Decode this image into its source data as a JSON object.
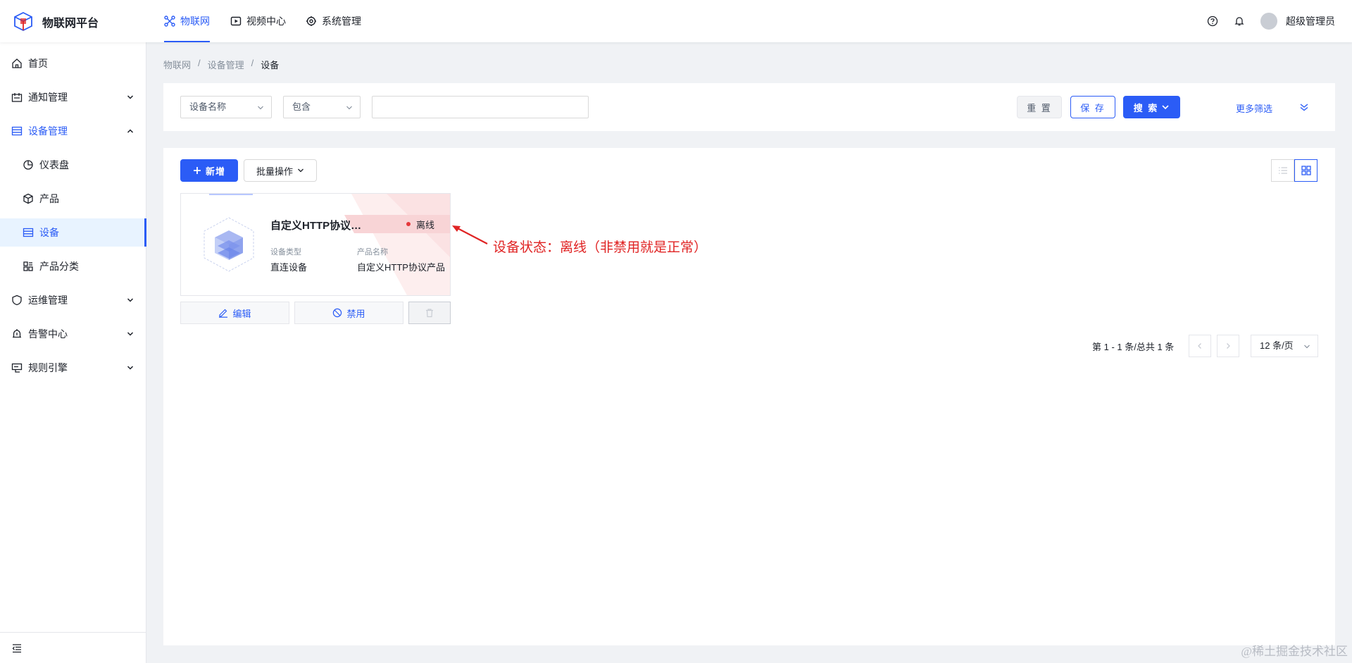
{
  "header": {
    "brand": "物联网平台",
    "nav": [
      {
        "label": "物联网",
        "icon": "iot-icon",
        "active": true
      },
      {
        "label": "视频中心",
        "icon": "video-icon",
        "active": false
      },
      {
        "label": "系统管理",
        "icon": "settings-icon",
        "active": false
      }
    ],
    "username": "超级管理员"
  },
  "sidebar": {
    "items": [
      {
        "label": "首页",
        "icon": "home-icon",
        "expandable": false
      },
      {
        "label": "通知管理",
        "icon": "notice-icon",
        "expandable": true
      },
      {
        "label": "设备管理",
        "icon": "device-mgmt-icon",
        "expandable": true,
        "open": true
      },
      {
        "label": "仪表盘",
        "icon": "dashboard-icon",
        "sub": true
      },
      {
        "label": "产品",
        "icon": "product-icon",
        "sub": true
      },
      {
        "label": "设备",
        "icon": "device-icon",
        "sub": true,
        "active": true
      },
      {
        "label": "产品分类",
        "icon": "category-icon",
        "sub": true
      },
      {
        "label": "运维管理",
        "icon": "ops-icon",
        "expandable": true
      },
      {
        "label": "告警中心",
        "icon": "alarm-icon",
        "expandable": true
      },
      {
        "label": "规则引擎",
        "icon": "rule-icon",
        "expandable": true
      }
    ]
  },
  "breadcrumb": {
    "items": [
      "物联网",
      "设备管理",
      "设备"
    ],
    "separator": "/"
  },
  "filter": {
    "field_select": "设备名称",
    "operator_select": "包含",
    "value": "",
    "reset_label": "重 置",
    "save_label": "保 存",
    "search_label": "搜 索",
    "more_filter_label": "更多筛选"
  },
  "toolbar": {
    "add_label": "新增",
    "batch_label": "批量操作"
  },
  "card": {
    "title": "自定义HTTP协议设备",
    "status": "离线",
    "status_color": "#e5383b",
    "device_type_label": "设备类型",
    "device_type_value": "直连设备",
    "product_name_label": "产品名称",
    "product_name_value": "自定义HTTP协议产品"
  },
  "card_actions": {
    "edit_label": "编辑",
    "disable_label": "禁用"
  },
  "pagination": {
    "info": "第 1 - 1 条/总共 1 条",
    "page_size": "12 条/页"
  },
  "annotation": {
    "text": "设备状态：离线（非禁用就是正常）",
    "color": "#e02424"
  },
  "watermark": "@稀土掘金技术社区",
  "colors": {
    "primary": "#2b5cf6",
    "annotation": "#e02424"
  }
}
